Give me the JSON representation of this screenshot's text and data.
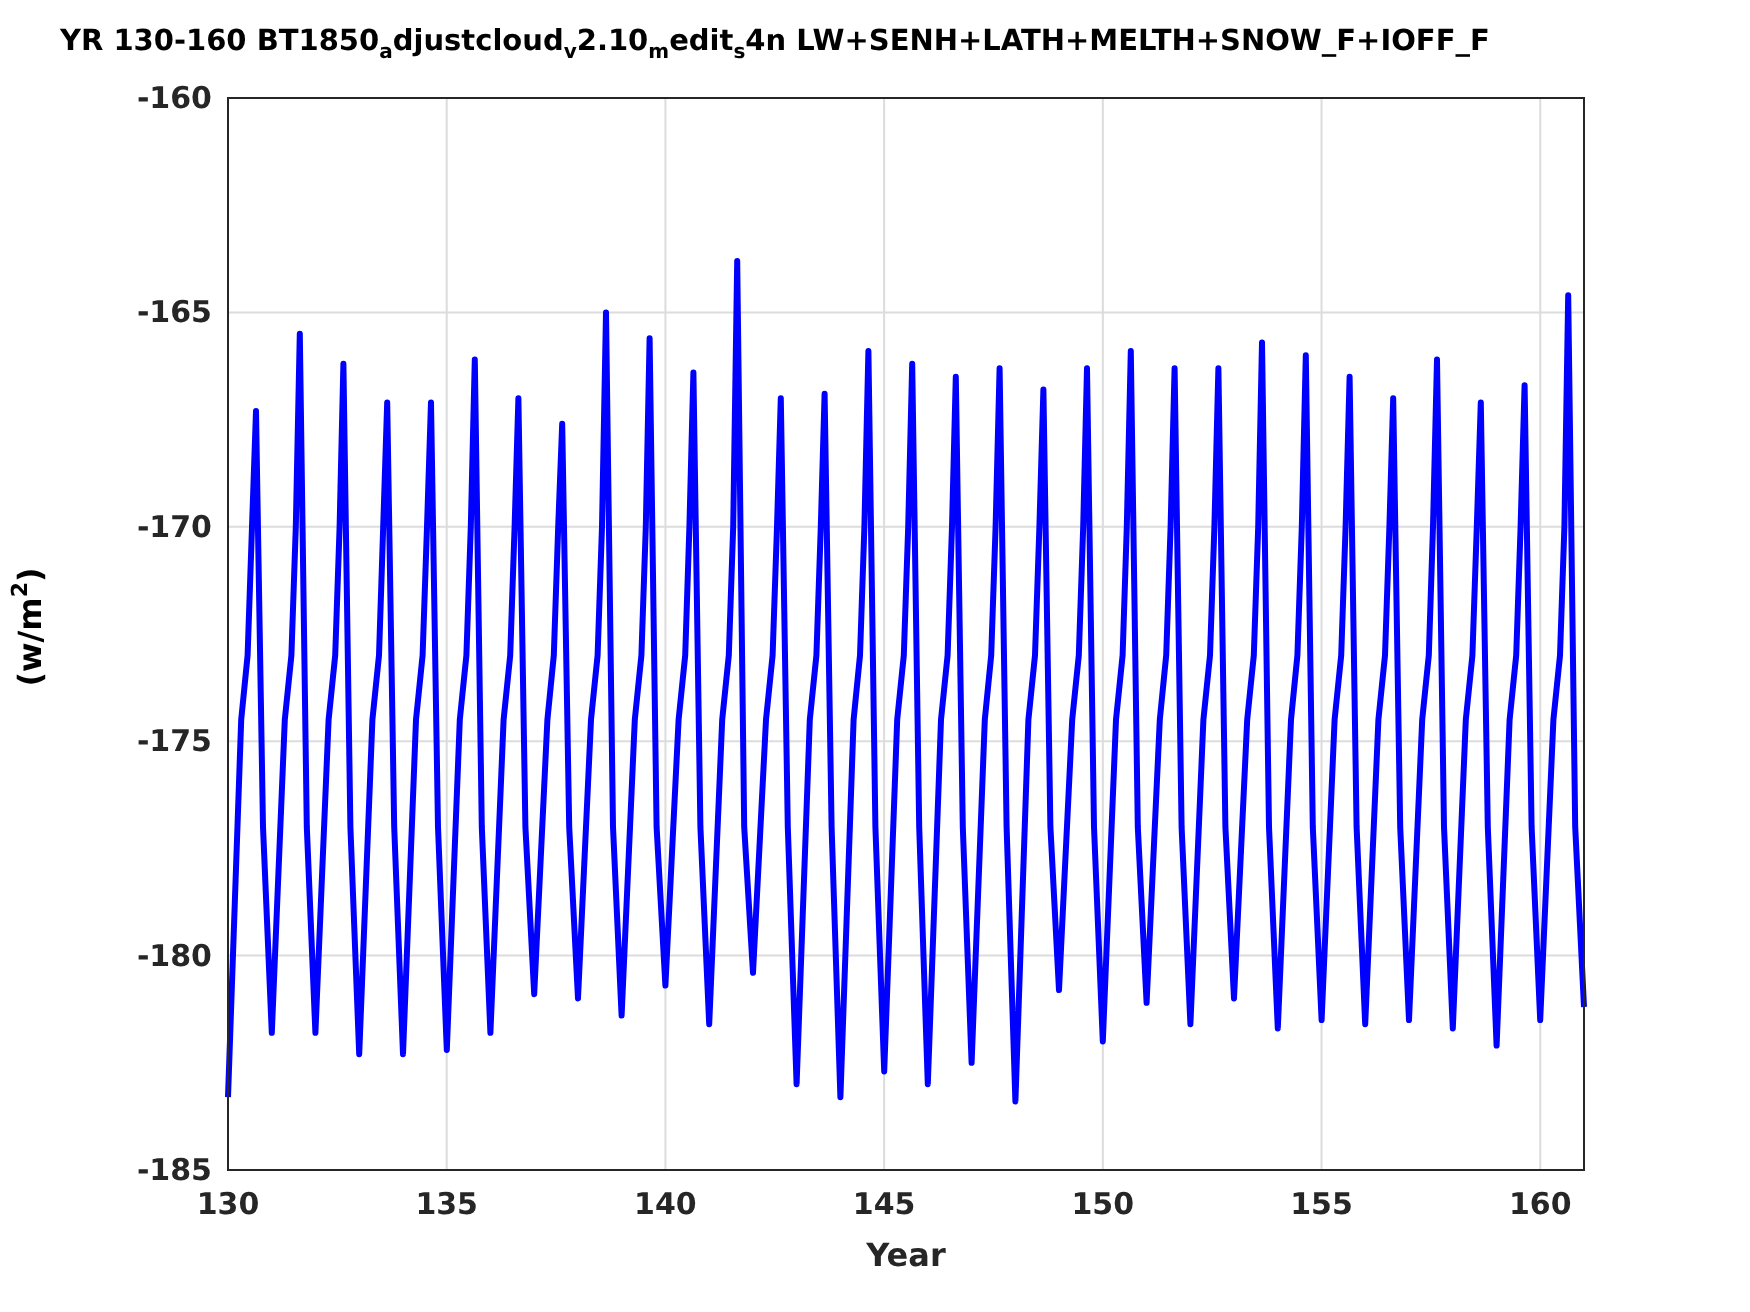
{
  "chart_data": {
    "type": "line",
    "title": "YR 130-160 BT1850$_{a}$djustcloud$_{v}$2.10$_{m}$edit$_{s}$4n LW+SENH+LATH+MELTH+SNOW_F+IOFF_F",
    "xlabel": "Year",
    "ylabel": "(w/m$^{2}$)",
    "x": [
      130,
      130.3,
      130.45,
      130.55,
      130.64,
      130.8,
      131,
      131.3,
      131.45,
      131.55,
      131.64,
      131.8,
      132,
      132.3,
      132.45,
      132.55,
      132.64,
      132.8,
      133,
      133.3,
      133.45,
      133.55,
      133.64,
      133.8,
      134,
      134.3,
      134.45,
      134.55,
      134.64,
      134.8,
      135,
      135.3,
      135.45,
      135.55,
      135.64,
      135.8,
      136,
      136.3,
      136.45,
      136.55,
      136.64,
      136.8,
      137,
      137.3,
      137.45,
      137.55,
      137.64,
      137.8,
      138,
      138.3,
      138.45,
      138.55,
      138.64,
      138.8,
      139,
      139.3,
      139.45,
      139.55,
      139.64,
      139.8,
      140,
      140.3,
      140.45,
      140.55,
      140.64,
      140.8,
      141,
      141.3,
      141.45,
      141.55,
      141.64,
      141.8,
      142,
      142.3,
      142.45,
      142.55,
      142.64,
      142.8,
      143,
      143.3,
      143.45,
      143.55,
      143.64,
      143.8,
      144,
      144.3,
      144.45,
      144.55,
      144.64,
      144.8,
      145,
      145.3,
      145.45,
      145.55,
      145.64,
      145.8,
      146,
      146.3,
      146.45,
      146.55,
      146.64,
      146.8,
      147,
      147.3,
      147.45,
      147.55,
      147.64,
      147.8,
      148,
      148.3,
      148.45,
      148.55,
      148.64,
      148.8,
      149,
      149.3,
      149.45,
      149.55,
      149.64,
      149.8,
      150,
      150.3,
      150.45,
      150.55,
      150.64,
      150.8,
      151,
      151.3,
      151.45,
      151.55,
      151.64,
      151.8,
      152,
      152.3,
      152.45,
      152.55,
      152.64,
      152.8,
      153,
      153.3,
      153.45,
      153.55,
      153.64,
      153.8,
      154,
      154.3,
      154.45,
      154.55,
      154.64,
      154.8,
      155,
      155.3,
      155.45,
      155.55,
      155.64,
      155.8,
      156,
      156.3,
      156.45,
      156.55,
      156.64,
      156.8,
      157,
      157.3,
      157.45,
      157.55,
      157.64,
      157.8,
      158,
      158.3,
      158.45,
      158.55,
      158.64,
      158.8,
      159,
      159.3,
      159.45,
      159.55,
      159.64,
      159.8,
      160,
      160.3,
      160.45,
      160.55,
      160.64,
      160.8,
      161
    ],
    "series": [
      {
        "color": "#0000ff",
        "values": [
          -183.3,
          -174.5,
          -173,
          -170,
          -167.3,
          -177,
          -181.8,
          -174.5,
          -173,
          -170,
          -165.5,
          -177,
          -181.8,
          -174.5,
          -173,
          -170,
          -166.2,
          -177,
          -182.3,
          -174.5,
          -173,
          -170,
          -167.1,
          -177,
          -182.3,
          -174.5,
          -173,
          -170,
          -167.1,
          -177,
          -182.2,
          -174.5,
          -173,
          -170,
          -166.1,
          -177,
          -181.8,
          -174.5,
          -173,
          -170,
          -167.0,
          -177,
          -180.9,
          -174.5,
          -173,
          -170,
          -167.6,
          -177,
          -181.0,
          -174.5,
          -173,
          -170,
          -165.0,
          -177,
          -181.4,
          -174.5,
          -173,
          -170,
          -165.6,
          -177,
          -180.7,
          -174.5,
          -173,
          -170,
          -166.4,
          -177,
          -181.6,
          -174.5,
          -173,
          -170,
          -163.8,
          -177,
          -180.4,
          -174.5,
          -173,
          -170,
          -167.0,
          -177,
          -183.0,
          -174.5,
          -173,
          -170,
          -166.9,
          -177,
          -183.3,
          -174.5,
          -173,
          -170,
          -165.9,
          -177,
          -182.7,
          -174.5,
          -173,
          -170,
          -166.2,
          -177,
          -183.0,
          -174.5,
          -173,
          -170,
          -166.5,
          -177,
          -182.5,
          -174.5,
          -173,
          -170,
          -166.3,
          -177,
          -183.4,
          -174.5,
          -173,
          -170,
          -166.8,
          -177,
          -180.8,
          -174.5,
          -173,
          -170,
          -166.3,
          -177,
          -182.0,
          -174.5,
          -173,
          -170,
          -165.9,
          -177,
          -181.1,
          -174.5,
          -173,
          -170,
          -166.3,
          -177,
          -181.6,
          -174.5,
          -173,
          -170,
          -166.3,
          -177,
          -181.0,
          -174.5,
          -173,
          -170,
          -165.7,
          -177,
          -181.7,
          -174.5,
          -173,
          -170,
          -166.0,
          -177,
          -181.5,
          -174.5,
          -173,
          -170,
          -166.5,
          -177,
          -181.6,
          -174.5,
          -173,
          -170,
          -167.0,
          -177,
          -181.5,
          -174.5,
          -173,
          -170,
          -166.1,
          -177,
          -181.7,
          -174.5,
          -173,
          -170,
          -167.1,
          -177,
          -182.1,
          -174.5,
          -173,
          -170,
          -166.7,
          -177,
          -181.5,
          -174.5,
          -173,
          -170,
          -164.6,
          -177,
          -181.2
        ]
      }
    ],
    "grid": true,
    "xlim": [
      130,
      161
    ],
    "ylim": [
      -185,
      -160
    ],
    "xticks": [
      130,
      135,
      140,
      145,
      150,
      155,
      160
    ],
    "yticks": [
      -185,
      -180,
      -175,
      -170,
      -165,
      -160
    ]
  }
}
